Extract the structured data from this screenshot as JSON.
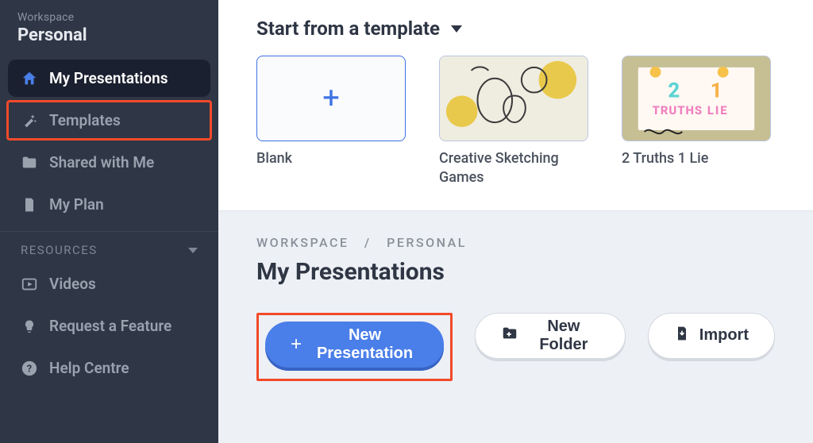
{
  "sidebar": {
    "workspace_label": "Workspace",
    "workspace_name": "Personal",
    "items": [
      {
        "label": "My Presentations"
      },
      {
        "label": "Templates"
      },
      {
        "label": "Shared with Me"
      },
      {
        "label": "My Plan"
      }
    ],
    "resources_header": "RESOURCES",
    "resources": [
      {
        "label": "Videos"
      },
      {
        "label": "Request a Feature"
      },
      {
        "label": "Help Centre"
      }
    ]
  },
  "templates": {
    "title": "Start from a template",
    "cards": [
      {
        "label": "Blank"
      },
      {
        "label": "Creative Sketching Games"
      },
      {
        "label": "2 Truths 1 Lie"
      }
    ]
  },
  "breadcrumb": {
    "part1": "WORKSPACE",
    "sep": "/",
    "part2": "PERSONAL"
  },
  "section_title": "My Presentations",
  "actions": {
    "new_presentation": "New Presentation",
    "new_folder": "New Folder",
    "import": "Import"
  }
}
